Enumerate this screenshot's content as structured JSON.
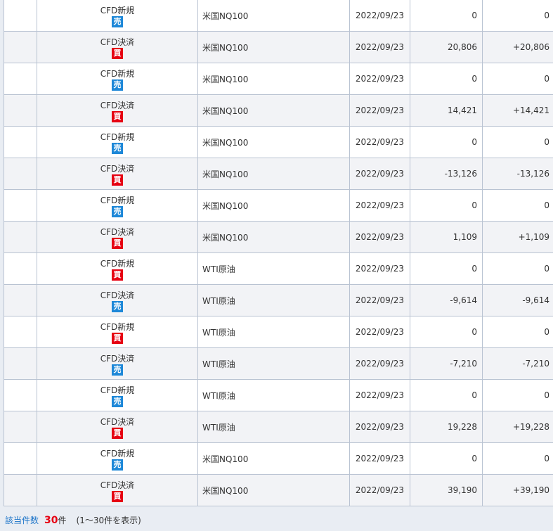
{
  "rows": [
    {
      "type": "CFD新規",
      "side": "売",
      "side_kind": "sell",
      "name": "米国NQ100",
      "date": "2022/09/23",
      "pl": "0",
      "pl_sign": "",
      "total": "0",
      "total_sign": ""
    },
    {
      "type": "CFD決済",
      "side": "買",
      "side_kind": "buy",
      "name": "米国NQ100",
      "date": "2022/09/23",
      "pl": "20,806",
      "pl_sign": "",
      "total": "+20,806",
      "total_sign": "pos"
    },
    {
      "type": "CFD新規",
      "side": "売",
      "side_kind": "sell",
      "name": "米国NQ100",
      "date": "2022/09/23",
      "pl": "0",
      "pl_sign": "",
      "total": "0",
      "total_sign": ""
    },
    {
      "type": "CFD決済",
      "side": "買",
      "side_kind": "buy",
      "name": "米国NQ100",
      "date": "2022/09/23",
      "pl": "14,421",
      "pl_sign": "",
      "total": "+14,421",
      "total_sign": "pos"
    },
    {
      "type": "CFD新規",
      "side": "売",
      "side_kind": "sell",
      "name": "米国NQ100",
      "date": "2022/09/23",
      "pl": "0",
      "pl_sign": "",
      "total": "0",
      "total_sign": ""
    },
    {
      "type": "CFD決済",
      "side": "買",
      "side_kind": "buy",
      "name": "米国NQ100",
      "date": "2022/09/23",
      "pl": "-13,126",
      "pl_sign": "neg",
      "total": "-13,126",
      "total_sign": "neg"
    },
    {
      "type": "CFD新規",
      "side": "売",
      "side_kind": "sell",
      "name": "米国NQ100",
      "date": "2022/09/23",
      "pl": "0",
      "pl_sign": "",
      "total": "0",
      "total_sign": ""
    },
    {
      "type": "CFD決済",
      "side": "買",
      "side_kind": "buy",
      "name": "米国NQ100",
      "date": "2022/09/23",
      "pl": "1,109",
      "pl_sign": "",
      "total": "+1,109",
      "total_sign": "pos"
    },
    {
      "type": "CFD新規",
      "side": "買",
      "side_kind": "buy",
      "name": "WTI原油",
      "date": "2022/09/23",
      "pl": "0",
      "pl_sign": "",
      "total": "0",
      "total_sign": ""
    },
    {
      "type": "CFD決済",
      "side": "売",
      "side_kind": "sell",
      "name": "WTI原油",
      "date": "2022/09/23",
      "pl": "-9,614",
      "pl_sign": "neg",
      "total": "-9,614",
      "total_sign": "neg"
    },
    {
      "type": "CFD新規",
      "side": "買",
      "side_kind": "buy",
      "name": "WTI原油",
      "date": "2022/09/23",
      "pl": "0",
      "pl_sign": "",
      "total": "0",
      "total_sign": ""
    },
    {
      "type": "CFD決済",
      "side": "売",
      "side_kind": "sell",
      "name": "WTI原油",
      "date": "2022/09/23",
      "pl": "-7,210",
      "pl_sign": "neg",
      "total": "-7,210",
      "total_sign": "neg"
    },
    {
      "type": "CFD新規",
      "side": "売",
      "side_kind": "sell",
      "name": "WTI原油",
      "date": "2022/09/23",
      "pl": "0",
      "pl_sign": "",
      "total": "0",
      "total_sign": ""
    },
    {
      "type": "CFD決済",
      "side": "買",
      "side_kind": "buy",
      "name": "WTI原油",
      "date": "2022/09/23",
      "pl": "19,228",
      "pl_sign": "",
      "total": "+19,228",
      "total_sign": "pos"
    },
    {
      "type": "CFD新規",
      "side": "売",
      "side_kind": "sell",
      "name": "米国NQ100",
      "date": "2022/09/23",
      "pl": "0",
      "pl_sign": "",
      "total": "0",
      "total_sign": ""
    },
    {
      "type": "CFD決済",
      "side": "買",
      "side_kind": "buy",
      "name": "米国NQ100",
      "date": "2022/09/23",
      "pl": "39,190",
      "pl_sign": "",
      "total": "+39,190",
      "total_sign": "pos"
    }
  ],
  "footer": {
    "label": "該当件数",
    "count": "30",
    "unit": "件",
    "range": "(1〜30件を表示)"
  },
  "colors": {
    "sell_badge": "#1e88d8",
    "buy_badge": "#e60012",
    "positive": "#e60012",
    "negative": "#1c1cd6"
  }
}
